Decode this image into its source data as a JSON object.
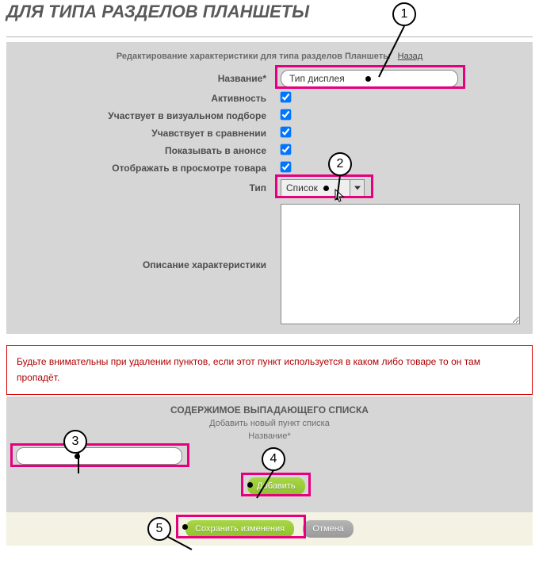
{
  "page_title": "ДЛЯ ТИПА РАЗДЕЛОВ ПЛАНШЕТЫ",
  "panel_header": "Редактирование характеристики для типа разделов Планшеты",
  "back_link": "Назад",
  "fields": {
    "name_label": "Название*",
    "name_value": "Тип дисплея",
    "active_label": "Активность",
    "active_checked": true,
    "visual_label": "Участвует в визуальном подборе",
    "visual_checked": true,
    "compare_label": "Учавствует в сравнении",
    "compare_checked": true,
    "announce_label": "Показывать в анонсе",
    "announce_checked": true,
    "product_view_label": "Отображать в просмотре товара",
    "product_view_checked": true,
    "type_label": "Тип",
    "type_value": "Список",
    "desc_label": "Описание характеристики",
    "desc_value": ""
  },
  "warning_text": "Будьте внимательны при удалении пунктов, если этот пункт используется в каком либо товаре то он там пропадёт.",
  "list_section": {
    "title": "СОДЕРЖИМОЕ ВЫПАДАЮЩЕГО СПИСКА",
    "subtitle": "Добавить новый пункт списка",
    "field_label": "Название*",
    "field_value": "",
    "add_btn": "Добавить"
  },
  "footer": {
    "save_btn": "Сохранить изменения",
    "cancel_btn": "Отмена"
  },
  "callouts": {
    "c1": "1",
    "c2": "2",
    "c3": "3",
    "c4": "4",
    "c5": "5"
  }
}
